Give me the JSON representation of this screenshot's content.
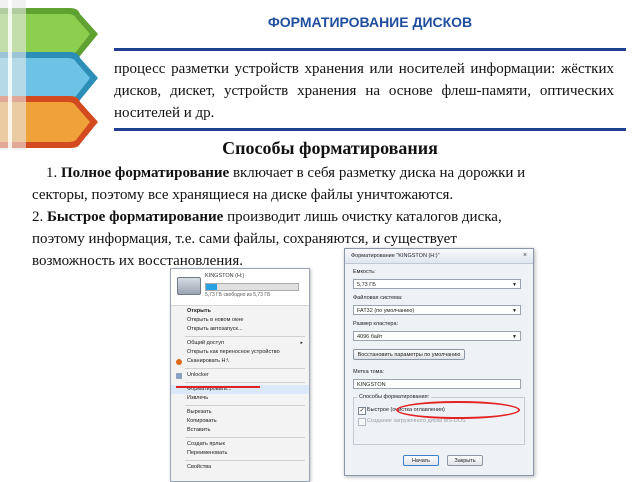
{
  "header": {
    "title": "ФОРМАТИРОВАНИЕ ДИСКОВ"
  },
  "intro": {
    "text": "процесс разметки устройств хранения или носителей информации: жёстких дисков, дискет, устройств хранения на основе флеш-памяти, оптических носителей и др."
  },
  "methods": {
    "title": "Способы форматирования",
    "item1_num": "1. ",
    "item1_term": "Полное форматирование",
    "item1_rest_line1": " включает в себя разметку диска на дорожки и",
    "item1_line2": "секторы, поэтому все хранящиеся на диске файлы уничтожаются.",
    "item2_num": "2. ",
    "item2_term": "Быстрое форматирование",
    "item2_rest_line1": " производит лишь очистку каталогов диска,",
    "item2_line2": "поэтому информация, т.е. сами файлы, сохраняются, и существует",
    "item2_line3": "возможность их восстановления."
  },
  "context_menu": {
    "drive_name": "KINGSTON (H:)",
    "drive_free": "5,73 ГБ свободно из 5,73 ГБ",
    "items": [
      "Открыть",
      "Открыть в новом окне",
      "Открыть автозапуск...",
      "Общий доступ",
      "Открыть как переносное устройство",
      "Сканировать H:\\",
      "Unlocker",
      "Форматировать...",
      "Извлечь",
      "Вырезать",
      "Копировать",
      "Вставить",
      "Создать ярлык",
      "Переименовать",
      "Свойства"
    ],
    "accent_color": "#e32222"
  },
  "format_dialog": {
    "title": "Форматирование \"KINGSTON (H:)\"",
    "capacity_label": "Емкость:",
    "capacity_value": "5,73 ГБ",
    "filesystem_label": "Файловая система:",
    "filesystem_value": "FAT32 (по умолчанию)",
    "cluster_label": "Размер кластера:",
    "cluster_value": "4096 байт",
    "restore_button": "Восстановить параметры по умолчанию",
    "volume_label": "Метка тома:",
    "volume_value": "KINGSTON",
    "options_label": "Способы форматирования:",
    "quick_format": "Быстрое (очистка оглавления)",
    "msdos_boot": "Создание загрузочного диска MS-DOS",
    "start_button": "Начать",
    "close_button": "Закрыть"
  }
}
